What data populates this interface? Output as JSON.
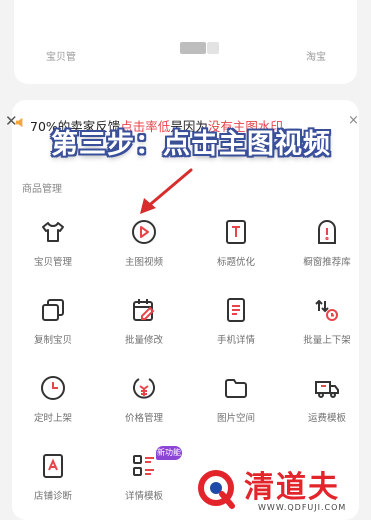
{
  "top_panel": {
    "items": [
      {
        "label": "宝贝管",
        "icon": "blurred"
      },
      {
        "label": "",
        "icon": "blurred-block"
      },
      {
        "label": "淘宝",
        "icon": "blurred"
      }
    ]
  },
  "notice": {
    "text_before": "70%的卖家反馈",
    "highlight_1": "点击率低",
    "text_middle": "是因为",
    "highlight_2": "没有主图水印",
    "close_label": "×",
    "prefix_x": "✕"
  },
  "overlay_title": "第三步：点击主图视频",
  "section": {
    "title": "商品管理"
  },
  "tools": [
    {
      "label": "宝贝管理",
      "icon": "tshirt-icon"
    },
    {
      "label": "主图视频",
      "icon": "play-circle-icon"
    },
    {
      "label": "标题优化",
      "icon": "text-t-icon"
    },
    {
      "label": "橱窗推荐库",
      "icon": "tombstone-alert-icon"
    },
    {
      "label": "复制宝贝",
      "icon": "copy-icon"
    },
    {
      "label": "批量修改",
      "icon": "calendar-edit-icon"
    },
    {
      "label": "手机详情",
      "icon": "document-icon"
    },
    {
      "label": "批量上下架",
      "icon": "up-down-clock-icon"
    },
    {
      "label": "定时上架",
      "icon": "clock-icon"
    },
    {
      "label": "价格管理",
      "icon": "price-tag-icon"
    },
    {
      "label": "图片空间",
      "icon": "folder-icon"
    },
    {
      "label": "运费模板",
      "icon": "truck-icon"
    },
    {
      "label": "店铺诊断",
      "icon": "search-doc-icon"
    },
    {
      "label": "详情模板",
      "icon": "list-grid-icon"
    }
  ],
  "new_badge": "新功能",
  "watermark": {
    "text": "清道夫",
    "url": "WWW.QDFUJI.COM"
  },
  "colors": {
    "accent_red": "#e3242b",
    "notice_red": "#e8454b",
    "icon_stroke": "#333333",
    "badge_purple": "#8a45d6",
    "overlay_blue": "#3a4f9a"
  }
}
